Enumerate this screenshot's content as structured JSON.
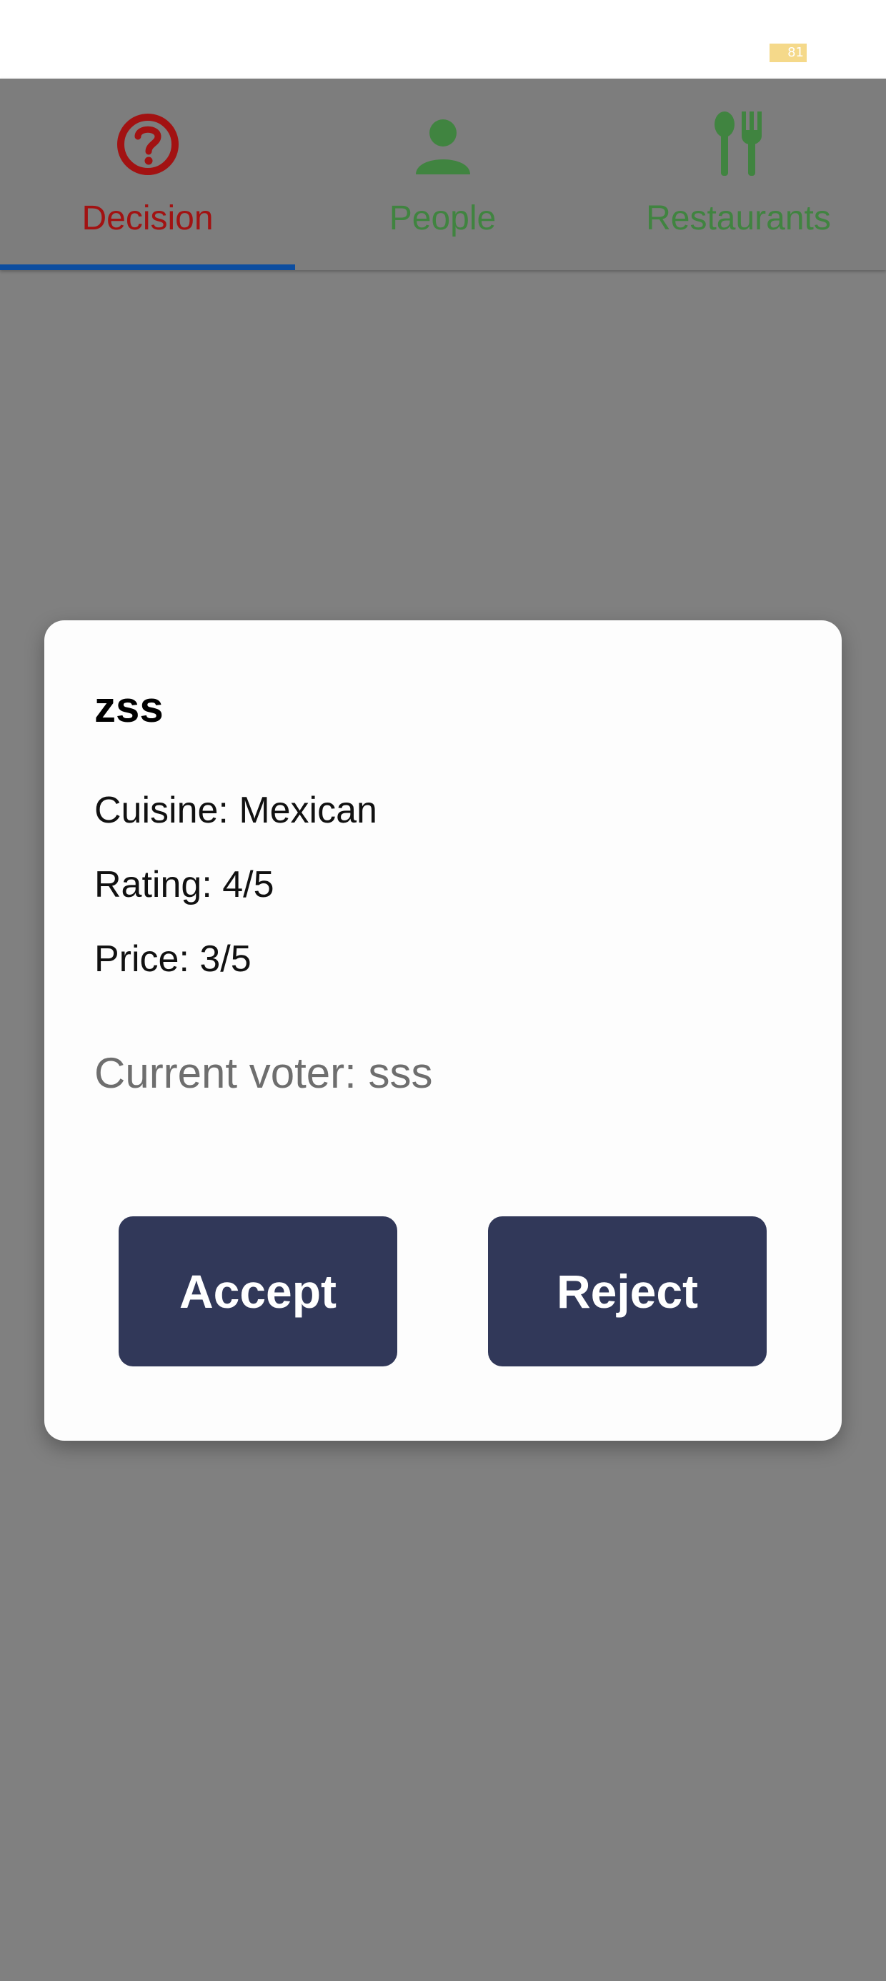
{
  "status_bar": {
    "battery_level": "81"
  },
  "tabs": [
    {
      "label": "Decision",
      "icon": "question-circle-icon",
      "selected": true
    },
    {
      "label": "People",
      "icon": "person-icon",
      "selected": false
    },
    {
      "label": "Restaurants",
      "icon": "fork-spoon-icon",
      "selected": false
    }
  ],
  "colors": {
    "tab_selected": "#a21212",
    "tab_unselected": "#408440",
    "indicator": "#0c4da0",
    "button_background": "#313859",
    "scrim": "#808080"
  },
  "dialog": {
    "restaurant_name": "zss",
    "cuisine": "Cuisine: Mexican",
    "rating": "Rating: 4/5",
    "price": "Price: 3/5",
    "current_voter": "Current voter: sss",
    "accept_label": "Accept",
    "reject_label": "Reject"
  }
}
